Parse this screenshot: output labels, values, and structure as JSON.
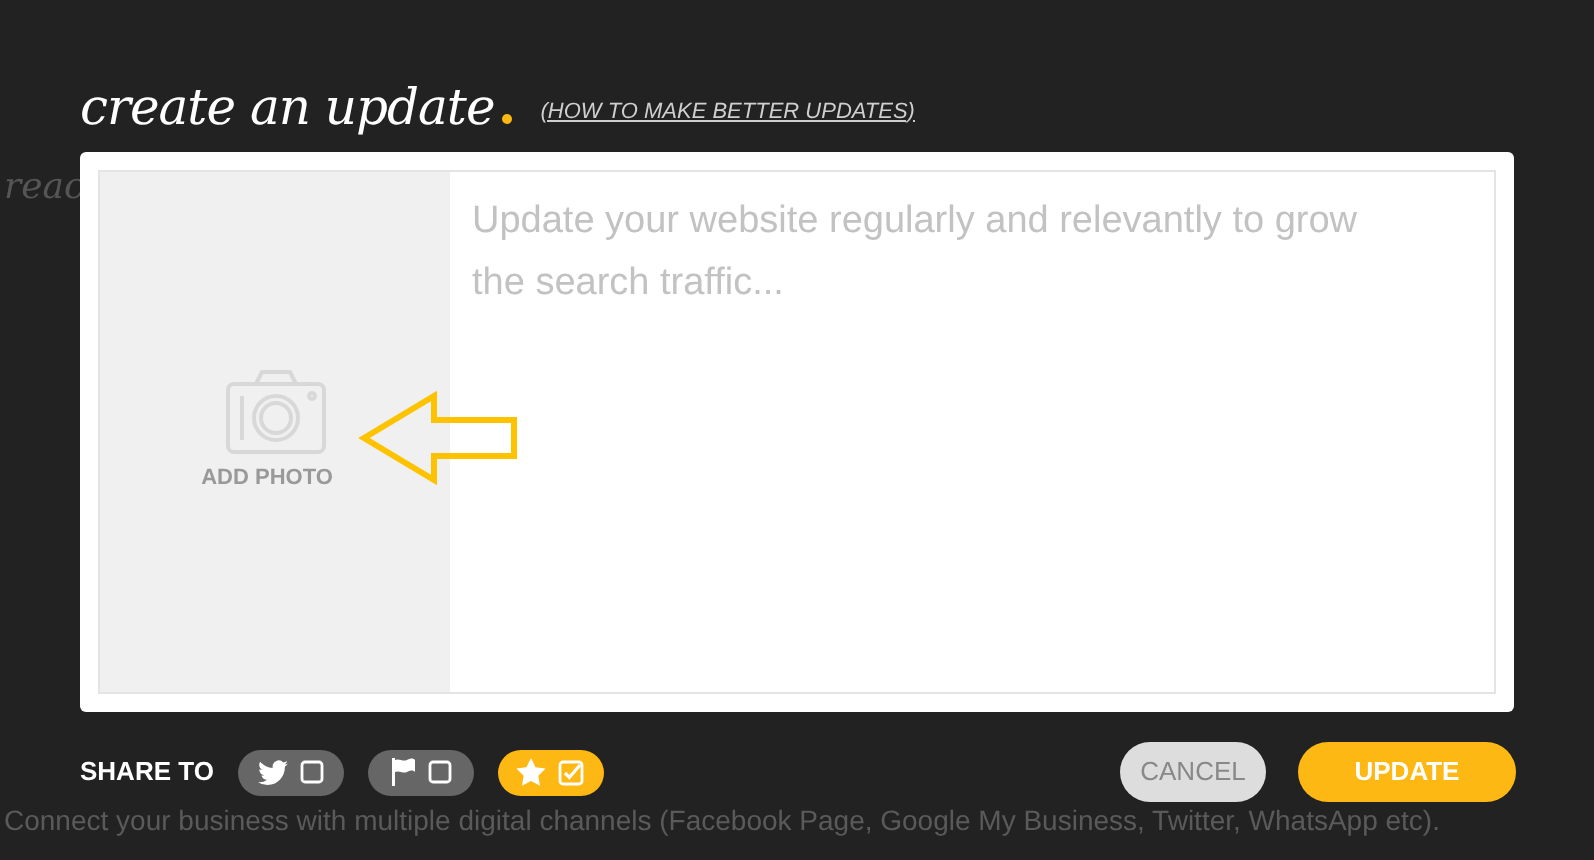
{
  "background_texts": [
    "reac",
    "Connect your business with multiple digital channels (Facebook Page, Google My Business, Twitter, WhatsApp etc)."
  ],
  "title": "create an update",
  "help_link": "(HOW TO MAKE BETTER UPDATES)",
  "photo": {
    "label": "ADD PHOTO"
  },
  "text_field": {
    "placeholder": "Update your website regularly and relevantly to grow the search traffic..."
  },
  "share_label": "SHARE TO",
  "share_options": [
    {
      "kind": "twitter",
      "checked": false
    },
    {
      "kind": "flag",
      "checked": false
    },
    {
      "kind": "star",
      "checked": true
    }
  ],
  "buttons": [
    {
      "kind": "secondary",
      "label": "CANCEL"
    },
    {
      "kind": "primary",
      "label": "UPDATE"
    }
  ]
}
